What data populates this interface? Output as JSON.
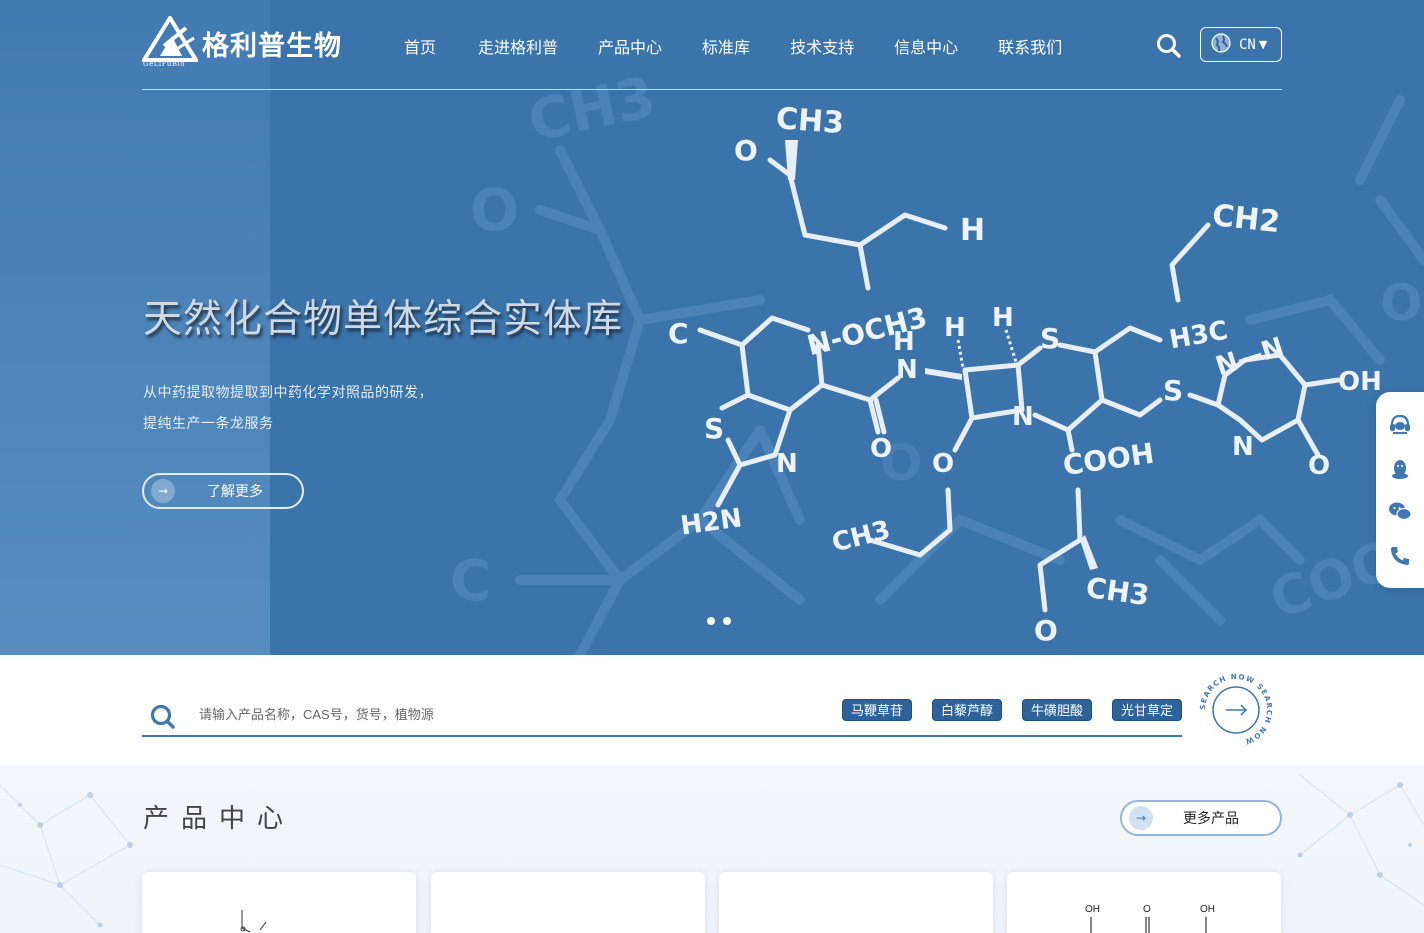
{
  "brand": {
    "name": "格利普生物",
    "sub": "GeLiPuBio"
  },
  "nav": {
    "items": [
      {
        "label": "首页"
      },
      {
        "label": "走进格利普"
      },
      {
        "label": "产品中心"
      },
      {
        "label": "标准库"
      },
      {
        "label": "技术支持"
      },
      {
        "label": "信息中心"
      },
      {
        "label": "联系我们"
      }
    ]
  },
  "header": {
    "search_icon": "search-icon",
    "lang_label": "CN",
    "lang_icon": "globe-icon"
  },
  "hero": {
    "title": "天然化合物单体综合实体库",
    "desc_line1": "从中药提取物提取到中药化学对照品的研发，",
    "desc_line2": "提纯生产一条龙服务",
    "button_label": "了解更多",
    "slides_count": 2,
    "formula": {
      "ch3_top": "CH3",
      "o_top": "O",
      "h_top": "H",
      "ch2": "CH2",
      "och3": "N-OCH3",
      "c_left": "C",
      "s_left": "S",
      "n_left": "N",
      "h2n": "H2N",
      "o_amide": "O",
      "nh": "N",
      "h1": "H",
      "h2": "H",
      "s_ring": "S",
      "n_ring": "N",
      "o_ring": "O",
      "cooh": "COOH",
      "h3c": "H3C",
      "s_right": "S",
      "nn": "N—N",
      "oh": "OH",
      "n_right": "N",
      "o_right": "O",
      "ch3_low": "CH3",
      "o_low": "O",
      "ch3_bottom": "CH3"
    }
  },
  "float_bar": {
    "items": [
      {
        "icon": "customer-service-icon"
      },
      {
        "icon": "qq-icon"
      },
      {
        "icon": "wechat-icon"
      },
      {
        "icon": "phone-icon"
      }
    ]
  },
  "search": {
    "placeholder": "请输入产品名称，CAS号，货号，植物源",
    "value": "",
    "tags": [
      "马鞭草苷",
      "白藜芦醇",
      "牛磺胆酸",
      "光甘草定"
    ],
    "badge_text": "SEARCH NOW SEARCH NOW"
  },
  "products": {
    "title": "产品中心",
    "more_label": "更多产品",
    "card_labels": [
      "OH",
      "O",
      "OH"
    ]
  },
  "colors": {
    "hero_bg": "#3a74ab",
    "accent": "#2d6399",
    "line": "#3f78b0"
  }
}
